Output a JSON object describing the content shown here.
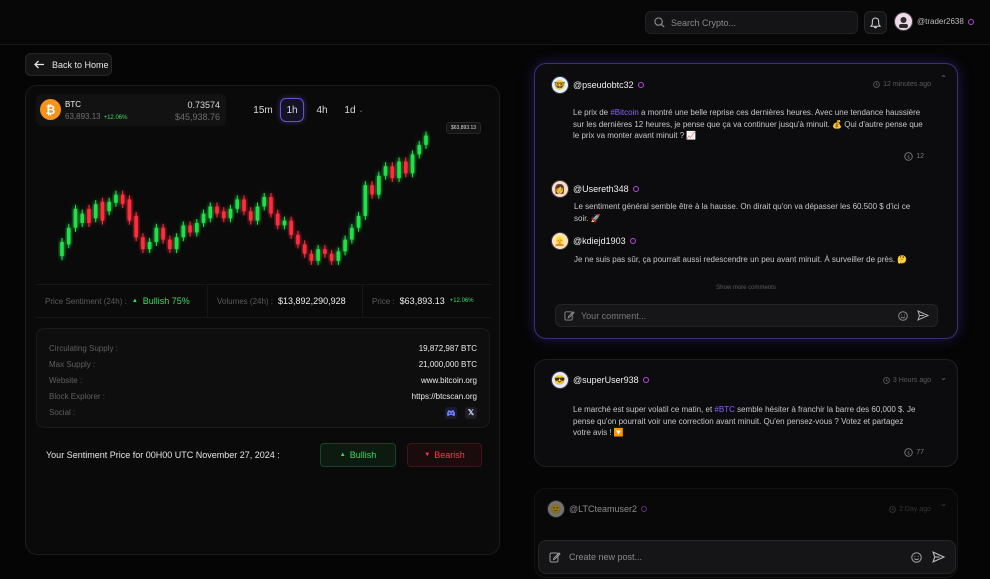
{
  "search": {
    "placeholder": "Search Crypto..."
  },
  "user": {
    "handle": "@trader2638"
  },
  "back_label": "Back to Home",
  "coin": {
    "symbol": "BTC",
    "price": "63,893.13",
    "change": "+12.06%",
    "right_top": "0.73574",
    "right_bottom": "$45,938.76"
  },
  "timeframes": [
    "15m",
    "1h",
    "4h",
    "1d"
  ],
  "active_timeframe": "1h",
  "price_tag": "$63,893.13",
  "chart_data": {
    "type": "candlestick",
    "candles": [
      {
        "o": 10,
        "c": 22
      },
      {
        "o": 20,
        "c": 34
      },
      {
        "o": 34,
        "c": 50
      },
      {
        "o": 38,
        "c": 46
      },
      {
        "o": 50,
        "c": 38
      },
      {
        "o": 42,
        "c": 54
      },
      {
        "o": 56,
        "c": 40
      },
      {
        "o": 48,
        "c": 56
      },
      {
        "o": 55,
        "c": 62
      },
      {
        "o": 62,
        "c": 54
      },
      {
        "o": 58,
        "c": 40
      },
      {
        "o": 44,
        "c": 26
      },
      {
        "o": 26,
        "c": 16
      },
      {
        "o": 16,
        "c": 22
      },
      {
        "o": 22,
        "c": 34
      },
      {
        "o": 34,
        "c": 24
      },
      {
        "o": 24,
        "c": 16
      },
      {
        "o": 16,
        "c": 26
      },
      {
        "o": 26,
        "c": 36
      },
      {
        "o": 36,
        "c": 30
      },
      {
        "o": 30,
        "c": 38
      },
      {
        "o": 38,
        "c": 46
      },
      {
        "o": 42,
        "c": 52
      },
      {
        "o": 52,
        "c": 46
      },
      {
        "o": 48,
        "c": 42
      },
      {
        "o": 42,
        "c": 50
      },
      {
        "o": 50,
        "c": 58
      },
      {
        "o": 58,
        "c": 48
      },
      {
        "o": 48,
        "c": 40
      },
      {
        "o": 40,
        "c": 52
      },
      {
        "o": 52,
        "c": 60
      },
      {
        "o": 60,
        "c": 46
      },
      {
        "o": 46,
        "c": 36
      },
      {
        "o": 36,
        "c": 40
      },
      {
        "o": 40,
        "c": 28
      },
      {
        "o": 28,
        "c": 20
      },
      {
        "o": 20,
        "c": 12
      },
      {
        "o": 12,
        "c": 6
      },
      {
        "o": 6,
        "c": 16
      },
      {
        "o": 16,
        "c": 12
      },
      {
        "o": 12,
        "c": 6
      },
      {
        "o": 6,
        "c": 14
      },
      {
        "o": 14,
        "c": 24
      },
      {
        "o": 24,
        "c": 34
      },
      {
        "o": 34,
        "c": 44
      },
      {
        "o": 44,
        "c": 70
      },
      {
        "o": 70,
        "c": 62
      },
      {
        "o": 62,
        "c": 78
      },
      {
        "o": 78,
        "c": 86
      },
      {
        "o": 86,
        "c": 76
      },
      {
        "o": 76,
        "c": 90
      },
      {
        "o": 90,
        "c": 80
      },
      {
        "o": 80,
        "c": 96
      },
      {
        "o": 96,
        "c": 104
      },
      {
        "o": 104,
        "c": 112
      }
    ],
    "ylim": [
      0,
      120
    ],
    "up_color": "#22e04a",
    "down_color": "#ff2d3d"
  },
  "stats": {
    "sentiment_label": "Price Sentiment (24h) :",
    "sentiment_value": "Bullish 75%",
    "volume_label": "Volumes (24h) :",
    "volume_value": "$13,892,290,928",
    "price_label": "Price :",
    "price_value": "$63,893.13",
    "price_change": "+12.06%"
  },
  "info": [
    {
      "label": "Circulating Supply :",
      "value": "19,872,987 BTC"
    },
    {
      "label": "Max Supply :",
      "value": "21,000,000 BTC"
    },
    {
      "label": "Website :",
      "value": "www.bitcoin.org"
    },
    {
      "label": "Block Explorer :",
      "value": "https://btcscan.org"
    },
    {
      "label": "Social :",
      "value": ""
    }
  ],
  "sentiment_prompt": "Your Sentiment Price for 00H00 UTC November  27, 2024 :",
  "bullish_label": "Bullish",
  "bearish_label": "Bearish",
  "post1": {
    "user": "@pseudobtc32",
    "time": "12 minutes ago",
    "text_pre": "Le prix de ",
    "hashtag": "#Bitcoin",
    "text_post": " a montré une belle reprise ces dernières heures. Avec une tendance haussière sur les dernières 12 heures, je pense que ça va continuer jusqu'à minuit. 💰 Qui d'autre pense que le prix va monter avant minuit ? 📈",
    "likes": "12",
    "comments": [
      {
        "user": "@Usereth348",
        "text": "Le sentiment général semble être à la hausse. On dirait qu'on va dépasser les 60.500 $ d'ici ce soir. 🚀"
      },
      {
        "user": "@kdiejd1903",
        "text": "Je ne suis pas sûr, ça pourrait aussi redescendre un peu avant minuit. À surveiller de près. 🤔"
      }
    ],
    "show_more": "Show more comments",
    "comment_placeholder": "Your comment..."
  },
  "post2": {
    "user": "@superUser938",
    "time": "3 Hours ago",
    "text_pre": "Le marché est super volatil ce matin, et ",
    "hashtag": "#BTC",
    "text_post": " semble hésiter à franchir la barre des 60,000 $. Je pense qu'on pourrait voir une correction avant minuit. Qu'en pensez-vous ? Votez et partagez votre avis ! 🔽",
    "likes": "77"
  },
  "post3": {
    "user": "@LTCteamuser2",
    "time": "2 Day ago"
  },
  "create_post_placeholder": "Create new post..."
}
